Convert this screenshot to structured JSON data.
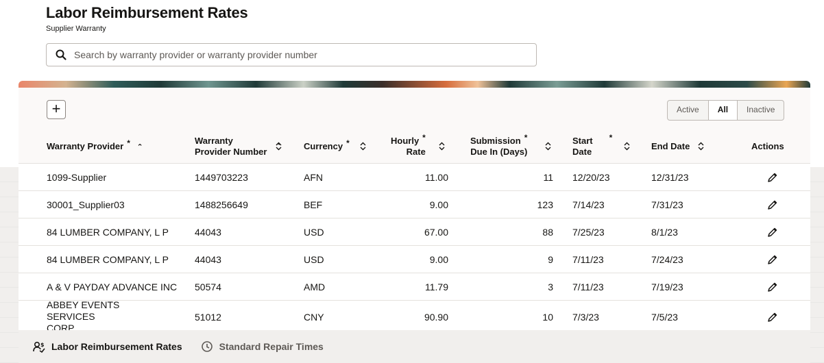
{
  "page": {
    "title": "Labor Reimbursement Rates",
    "subtitle": "Supplier Warranty"
  },
  "search": {
    "placeholder": "Search by warranty provider or warranty provider number",
    "value": ""
  },
  "toolbar": {
    "add_label": "+",
    "filters": [
      "Active",
      "All",
      "Inactive"
    ],
    "selected_filter": "All"
  },
  "columns": {
    "warranty_provider": "Warranty Provider",
    "provider_number_1": "Warranty",
    "provider_number_2": "Provider Number",
    "currency": "Currency",
    "hourly_rate_1": "Hourly",
    "hourly_rate_2": "Rate",
    "submission_1": "Submission",
    "submission_2": "Due In (Days)",
    "start_date_1": "Start",
    "start_date_2": "Date",
    "end_date": "End Date",
    "actions": "Actions",
    "required_mark": "*",
    "sort_asc": "^",
    "sort_both": "⌃⌄"
  },
  "rows": [
    {
      "provider": "1099-Supplier",
      "number": "1449703223",
      "currency": "AFN",
      "rate": "11.00",
      "due": "11",
      "start": "12/20/23",
      "end": "12/31/23"
    },
    {
      "provider": "30001_Supplier03",
      "number": "1488256649",
      "currency": "BEF",
      "rate": "9.00",
      "due": "123",
      "start": "7/14/23",
      "end": "7/31/23"
    },
    {
      "provider": "84 LUMBER COMPANY, L P",
      "number": "44043",
      "currency": "USD",
      "rate": "67.00",
      "due": "88",
      "start": "7/25/23",
      "end": "8/1/23"
    },
    {
      "provider": "84 LUMBER COMPANY, L P",
      "number": "44043",
      "currency": "USD",
      "rate": "9.00",
      "due": "9",
      "start": "7/11/23",
      "end": "7/24/23"
    },
    {
      "provider": "A & V PAYDAY ADVANCE INC",
      "number": "50574",
      "currency": "AMD",
      "rate": "11.79",
      "due": "3",
      "start": "7/11/23",
      "end": "7/19/23"
    },
    {
      "provider": "ABBEY EVENTS SERVICES CORP",
      "provider_line1": "ABBEY EVENTS SERVICES",
      "provider_line2": "CORP",
      "number": "51012",
      "currency": "CNY",
      "rate": "90.90",
      "due": "10",
      "start": "7/3/23",
      "end": "7/5/23"
    }
  ],
  "footer_tabs": [
    {
      "label": "Labor Reimbursement Rates",
      "icon": "rates-icon",
      "active": true
    },
    {
      "label": "Standard Repair Times",
      "icon": "clock-icon",
      "active": false
    }
  ]
}
